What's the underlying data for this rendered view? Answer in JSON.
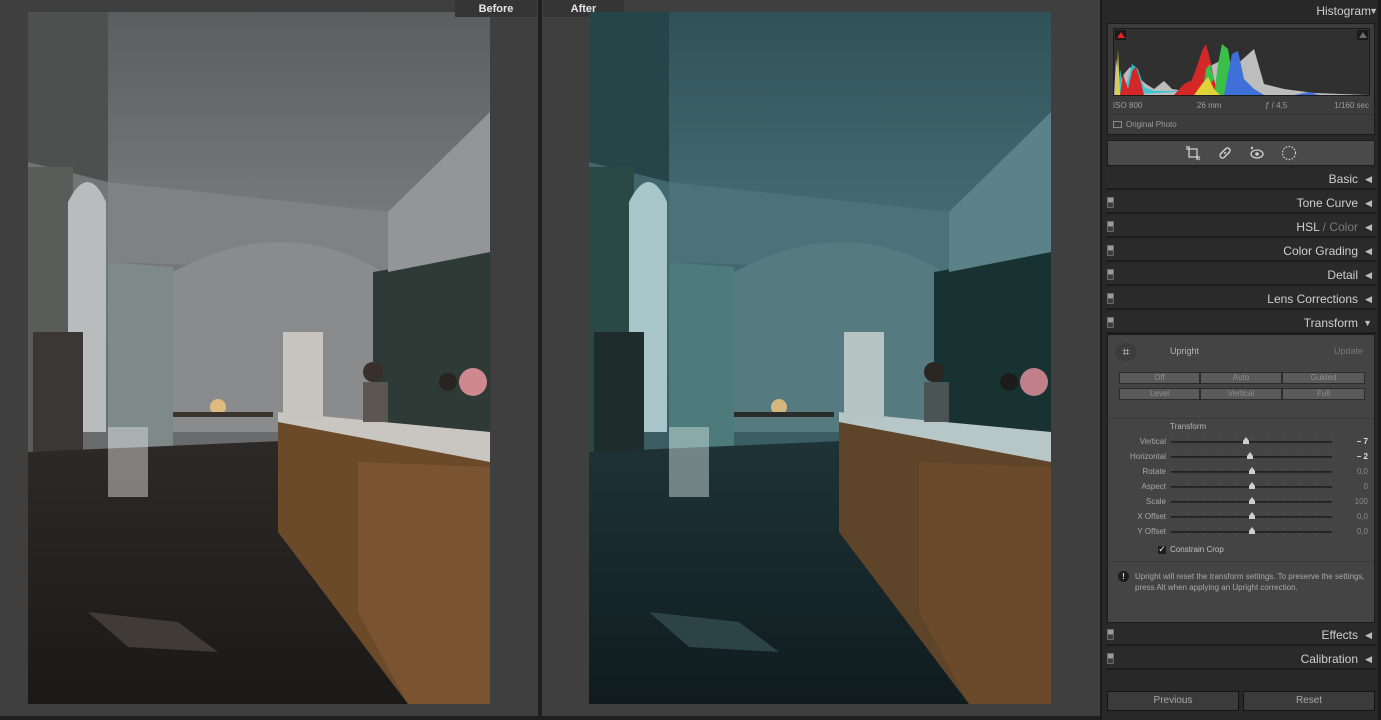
{
  "view": {
    "before_label": "Before",
    "after_label": "After"
  },
  "histogram": {
    "title": "Histogram",
    "iso": "ISO 800",
    "focal_length": "26 mm",
    "aperture": "ƒ / 4,5",
    "shutter": "1/160 sec",
    "original_photo_label": "Original Photo",
    "clip_shadow_color": "#e32222"
  },
  "tools": [
    {
      "name": "crop-overlay-icon"
    },
    {
      "name": "spot-removal-icon"
    },
    {
      "name": "red-eye-icon"
    },
    {
      "name": "masking-icon"
    }
  ],
  "sections": [
    {
      "title": "Basic",
      "dim": "",
      "expanded": false,
      "toggle": false
    },
    {
      "title": "Tone Curve",
      "dim": "",
      "expanded": false,
      "toggle": true
    },
    {
      "title": "HSL",
      "dim": " / Color",
      "expanded": false,
      "toggle": true
    },
    {
      "title": "Color Grading",
      "dim": "",
      "expanded": false,
      "toggle": true
    },
    {
      "title": "Detail",
      "dim": "",
      "expanded": false,
      "toggle": true
    },
    {
      "title": "Lens Corrections",
      "dim": "",
      "expanded": false,
      "toggle": true
    },
    {
      "title": "Transform",
      "dim": "",
      "expanded": true,
      "toggle": true
    },
    {
      "title": "Effects",
      "dim": "",
      "expanded": false,
      "toggle": true
    },
    {
      "title": "Calibration",
      "dim": "",
      "expanded": false,
      "toggle": true
    }
  ],
  "transform": {
    "upright_label": "Upright",
    "update_label": "Update",
    "upright_buttons": [
      "Off",
      "Auto",
      "Guided",
      "Level",
      "Vertical",
      "Full"
    ],
    "subheading": "Transform",
    "sliders": [
      {
        "label": "Vertical",
        "value": "− 7",
        "numeric": -7,
        "min": -100,
        "max": 100,
        "strong": true
      },
      {
        "label": "Horizontal",
        "value": "− 2",
        "numeric": -2,
        "min": -100,
        "max": 100,
        "strong": true
      },
      {
        "label": "Rotate",
        "value": "0,0",
        "numeric": 0,
        "min": -10,
        "max": 10,
        "strong": false
      },
      {
        "label": "Aspect",
        "value": "0",
        "numeric": 0,
        "min": -100,
        "max": 100,
        "strong": false
      },
      {
        "label": "Scale",
        "value": "100",
        "numeric": 100,
        "min": 50,
        "max": 150,
        "strong": false
      },
      {
        "label": "X Offset",
        "value": "0,0",
        "numeric": 0,
        "min": -100,
        "max": 100,
        "strong": false
      },
      {
        "label": "Y Offset",
        "value": "0,0",
        "numeric": 0,
        "min": -100,
        "max": 100,
        "strong": false
      }
    ],
    "constrain_crop_label": "Constrain Crop",
    "constrain_crop_checked": true,
    "warning": "Upright will reset the transform settings. To preserve the settings, press Alt when applying an Upright correction."
  },
  "footer": {
    "previous_label": "Previous",
    "reset_label": "Reset"
  }
}
